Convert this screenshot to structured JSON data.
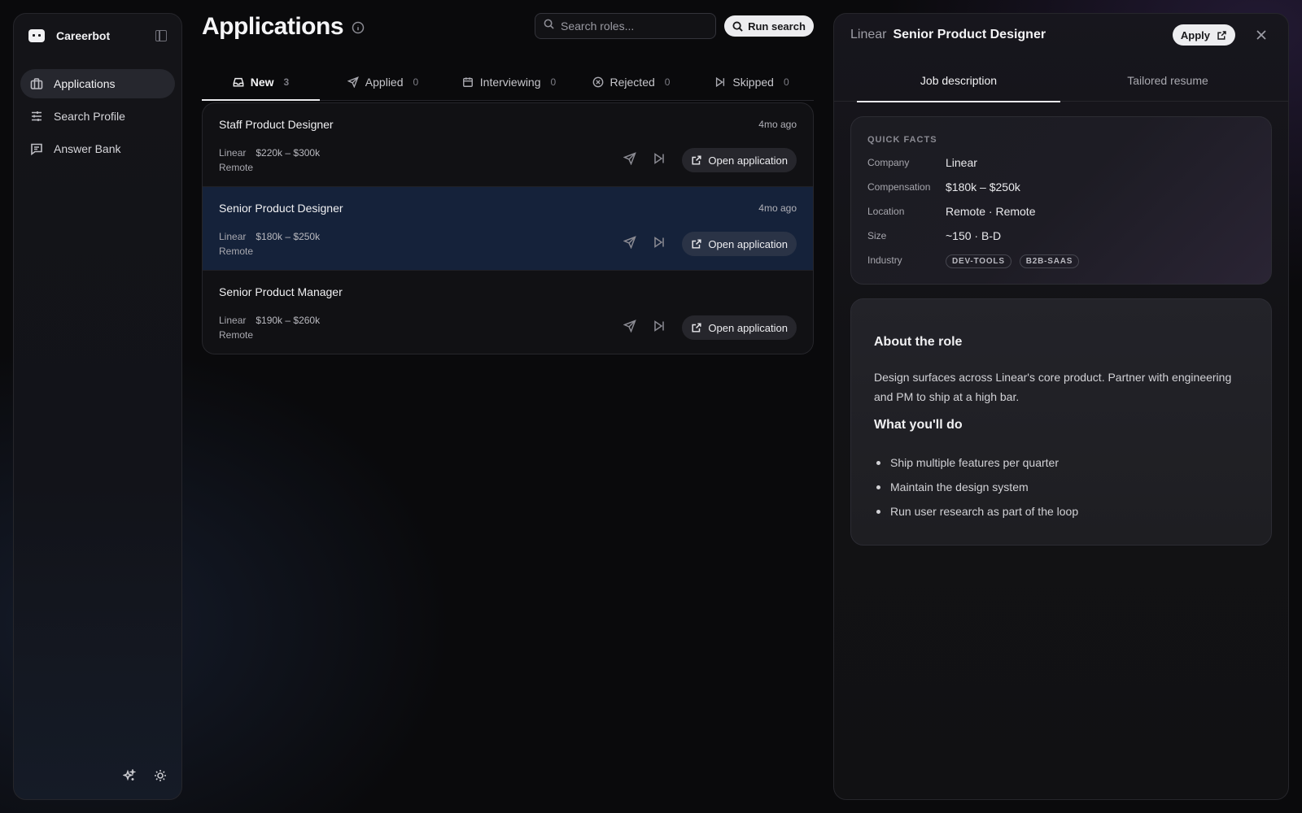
{
  "sidebar": {
    "brand": "Careerbot",
    "items": [
      {
        "label": "Applications",
        "icon": "briefcase-icon",
        "active": true
      },
      {
        "label": "Search Profile",
        "icon": "sliders-icon",
        "active": false
      },
      {
        "label": "Answer Bank",
        "icon": "message-square-icon",
        "active": false
      }
    ]
  },
  "main": {
    "title": "Applications",
    "search_placeholder": "Search roles...",
    "run_search_label": "Run search",
    "tabs": [
      {
        "label": "New",
        "count": "3",
        "icon": "inbox-icon",
        "active": true
      },
      {
        "label": "Applied",
        "count": "0",
        "icon": "send-icon",
        "active": false
      },
      {
        "label": "Interviewing",
        "count": "0",
        "icon": "calendar-icon",
        "active": false
      },
      {
        "label": "Rejected",
        "count": "0",
        "icon": "x-circle-icon",
        "active": false
      },
      {
        "label": "Skipped",
        "count": "0",
        "icon": "skip-icon",
        "active": false
      }
    ],
    "rows": [
      {
        "title": "Staff Product Designer",
        "time": "4mo ago",
        "company": "Linear",
        "salary": "$220k – $300k",
        "location": "Remote",
        "open_label": "Open application",
        "selected": false
      },
      {
        "title": "Senior Product Designer",
        "time": "4mo ago",
        "company": "Linear",
        "salary": "$180k – $250k",
        "location": "Remote",
        "open_label": "Open application",
        "selected": true
      },
      {
        "title": "Senior Product Manager",
        "time": "",
        "company": "Linear",
        "salary": "$190k – $260k",
        "location": "Remote",
        "open_label": "Open application",
        "selected": false
      }
    ]
  },
  "panel": {
    "company": "Linear",
    "title": "Senior Product Designer",
    "apply_label": "Apply",
    "tabs": [
      {
        "label": "Job description",
        "active": true
      },
      {
        "label": "Tailored resume",
        "active": false
      }
    ],
    "facts": {
      "label": "QUICK FACTS",
      "company_key": "Company",
      "company_val": "Linear",
      "comp_key": "Compensation",
      "comp_val": "$180k – $250k",
      "location_key": "Location",
      "location_val": "Remote · Remote",
      "size_key": "Size",
      "size_val": "~150 · B-D",
      "industry_key": "Industry",
      "industry_tags": [
        "DEV-TOOLS",
        "B2B-SAAS"
      ]
    },
    "about": {
      "heading": "About the role",
      "body": "Design surfaces across Linear's core product. Partner with engineering and PM to ship at a high bar.",
      "todo_heading": "What you'll do",
      "bullets": [
        "Ship multiple features per quarter",
        "Maintain the design system",
        "Run user research as part of the loop"
      ]
    }
  },
  "colors": {
    "accent_selected_row": "#15223a",
    "background": "#0a0a0c"
  }
}
